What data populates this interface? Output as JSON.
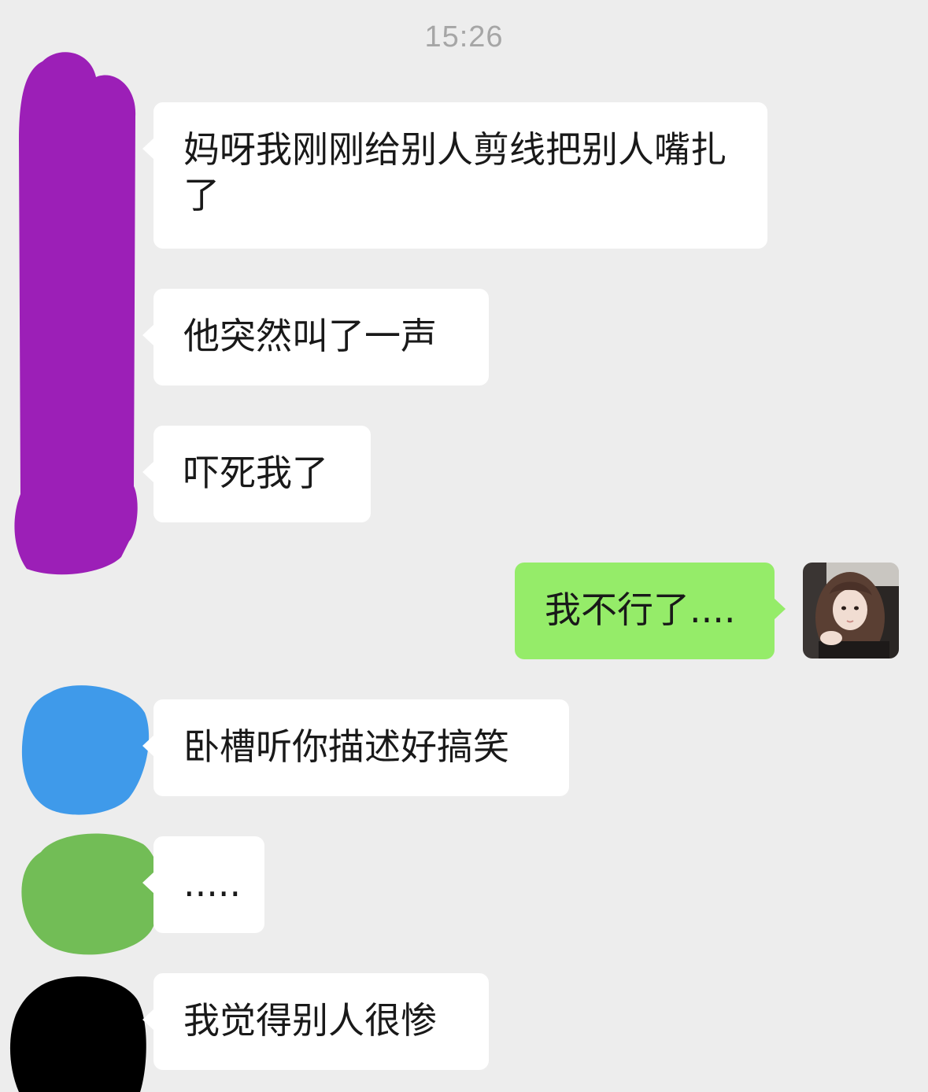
{
  "chat": {
    "timestamp": "15:26",
    "messages": [
      {
        "side": "left",
        "sender": "contact-1",
        "text": "妈呀我刚刚给别人剪线把别人嘴扎了"
      },
      {
        "side": "left",
        "sender": "contact-1",
        "text": "他突然叫了一声"
      },
      {
        "side": "left",
        "sender": "contact-1",
        "text": "吓死我了"
      },
      {
        "side": "right",
        "sender": "me",
        "text": "我不行了...."
      },
      {
        "side": "left",
        "sender": "contact-2",
        "text": "卧槽听你描述好搞笑"
      },
      {
        "side": "left",
        "sender": "contact-3",
        "text": "....."
      },
      {
        "side": "left",
        "sender": "contact-4",
        "text": "我觉得别人很惨"
      }
    ]
  },
  "colors": {
    "background": "#ededed",
    "incoming_bubble": "#ffffff",
    "outgoing_bubble": "#95ec69",
    "scribble_purple": "#9c1fb7",
    "scribble_blue": "#3f9aea",
    "scribble_green": "#72bd56",
    "scribble_black": "#000000"
  }
}
